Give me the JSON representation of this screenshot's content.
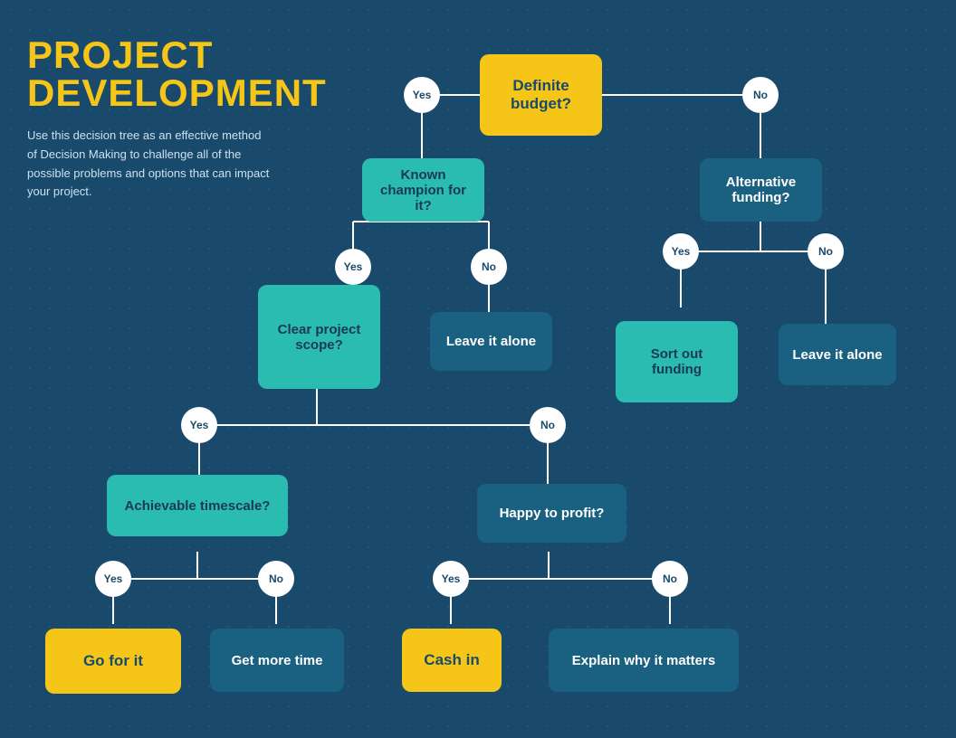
{
  "title": {
    "line1": "PROJECT",
    "line2": "DEVELOPMENT",
    "description": "Use this decision tree as an effective method of Decision Making to challenge all of the possible problems and options that can impact your project."
  },
  "nodes": {
    "definite_budget": "Definite budget?",
    "known_champion": "Known champion for it?",
    "alternative_funding": "Alternative funding?",
    "clear_project_scope": "Clear project scope?",
    "leave_it_alone_1": "Leave it alone",
    "sort_out_funding": "Sort out funding",
    "leave_it_alone_2": "Leave it alone",
    "achievable_timescale": "Achievable timescale?",
    "happy_to_profit": "Happy to profit?",
    "go_for_it": "Go for it",
    "get_more_time": "Get more time",
    "cash_in": "Cash in",
    "explain_why": "Explain why it matters"
  },
  "labels": {
    "yes": "Yes",
    "no": "No"
  },
  "colors": {
    "bg": "#1a4a6b",
    "yellow": "#f5c518",
    "teal": "#2abcb0",
    "dark_teal": "#1a6080",
    "white": "#ffffff",
    "text_dark": "#1a3a52"
  }
}
